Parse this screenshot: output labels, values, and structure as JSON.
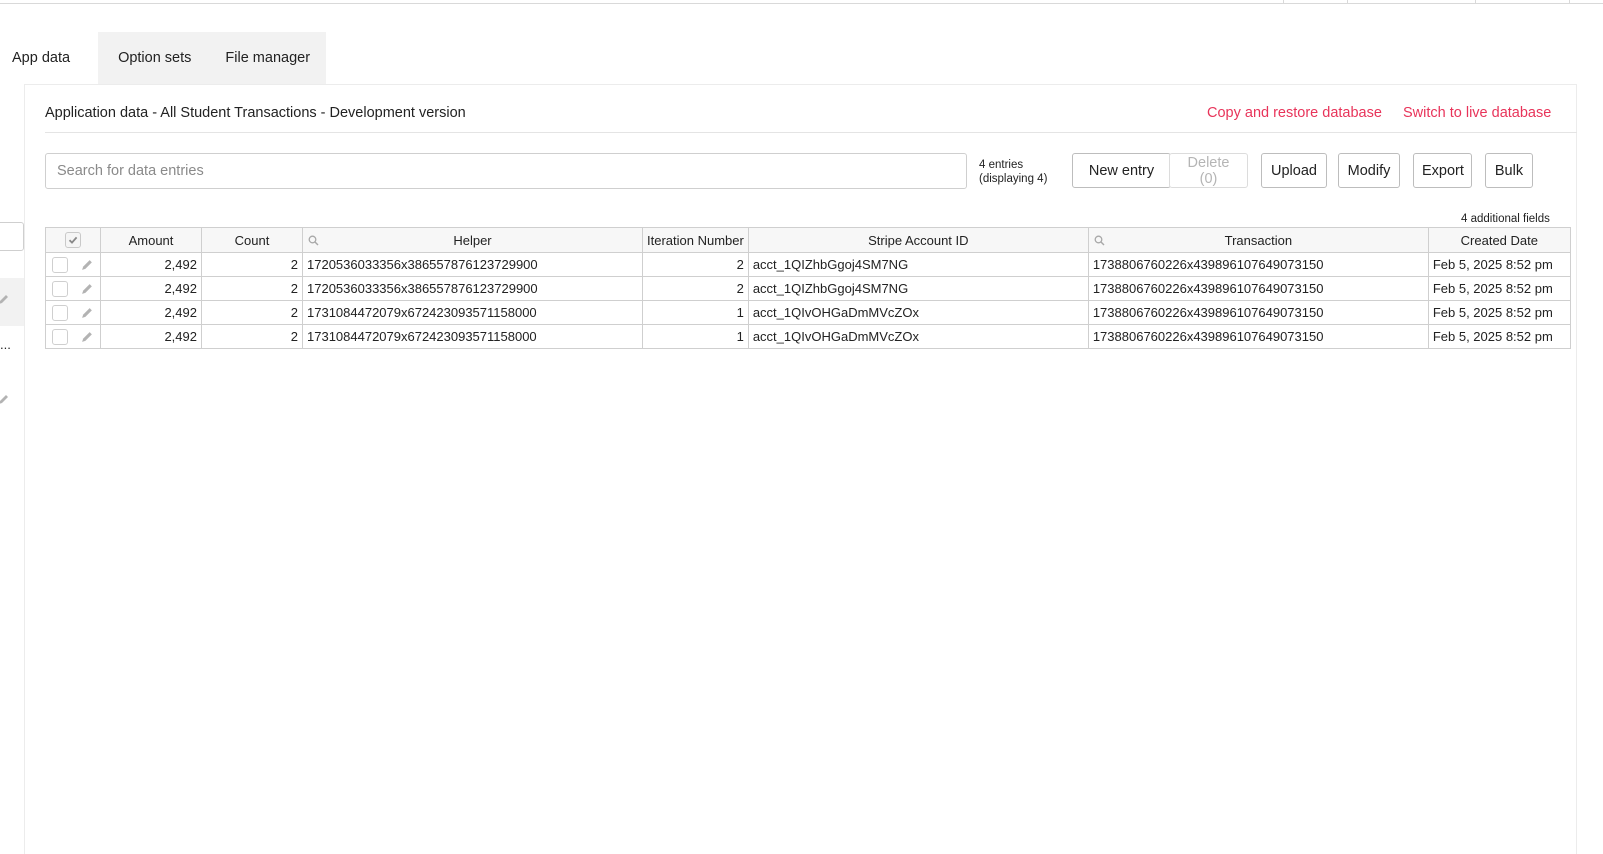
{
  "tabs": [
    {
      "label": "App data",
      "active": true
    },
    {
      "label": "Option sets",
      "active": false
    },
    {
      "label": "File manager",
      "active": false
    }
  ],
  "left_strip": {
    "truncated_text": "..."
  },
  "header": {
    "title": "Application data - All Student Transactions - Development version",
    "copy_restore_label": "Copy and restore database",
    "switch_live_label": "Switch to live database",
    "link_color": "#e8345a"
  },
  "search": {
    "placeholder": "Search for data entries",
    "value": ""
  },
  "entries": {
    "count_text": "4 entries",
    "displaying_text": "(displaying 4)"
  },
  "toolbar": {
    "new_entry": "New entry",
    "delete": "Delete (0)",
    "upload": "Upload",
    "modify": "Modify",
    "export": "Export",
    "bulk": "Bulk"
  },
  "additional_fields": "4 additional fields",
  "table": {
    "columns": [
      "Amount",
      "Count",
      "Helper",
      "Iteration Number",
      "Stripe Account ID",
      "Transaction",
      "Created Date"
    ],
    "searchable_columns": [
      "Helper",
      "Transaction"
    ],
    "rows": [
      [
        "2,492",
        "2",
        "1720536033356x386557876123729900",
        "2",
        "acct_1QIZhbGgoj4SM7NG",
        "1738806760226x439896107649073150",
        "Feb 5, 2025 8:52 pm"
      ],
      [
        "2,492",
        "2",
        "1720536033356x386557876123729900",
        "2",
        "acct_1QIZhbGgoj4SM7NG",
        "1738806760226x439896107649073150",
        "Feb 5, 2025 8:52 pm"
      ],
      [
        "2,492",
        "2",
        "1731084472079x672423093571158000",
        "1",
        "acct_1QIvOHGaDmMVcZOx",
        "1738806760226x439896107649073150",
        "Feb 5, 2025 8:52 pm"
      ],
      [
        "2,492",
        "2",
        "1731084472079x672423093571158000",
        "1",
        "acct_1QIvOHGaDmMVcZOx",
        "1738806760226x439896107649073150",
        "Feb 5, 2025 8:52 pm"
      ]
    ]
  },
  "icons": {
    "select_all": "checkmark-icon",
    "row_edit": "pencil-icon",
    "column_search": "magnifier-icon"
  }
}
